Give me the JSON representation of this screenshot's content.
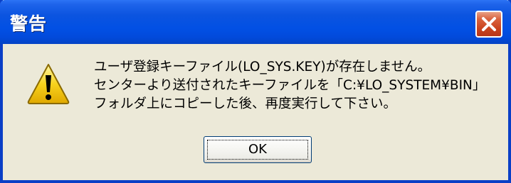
{
  "window": {
    "title": "警告"
  },
  "message": {
    "lines": [
      "ユーザ登録キーファイル(LO_SYS.KEY)が存在しません。",
      "センターより送付されたキーファイルを「C:¥LO_SYSTEM¥BIN」",
      "フォルダ上にコピーした後、再度実行して下さい。"
    ]
  },
  "buttons": {
    "ok_label": "OK"
  },
  "icons": {
    "close": "close-icon",
    "warning": "warning-icon"
  },
  "colors": {
    "titlebar": "#0250e4",
    "frame": "#0a3fc6",
    "dialog_background": "#ece9d8",
    "close_button": "#d9623e",
    "warning_yellow": "#f7d21c"
  }
}
